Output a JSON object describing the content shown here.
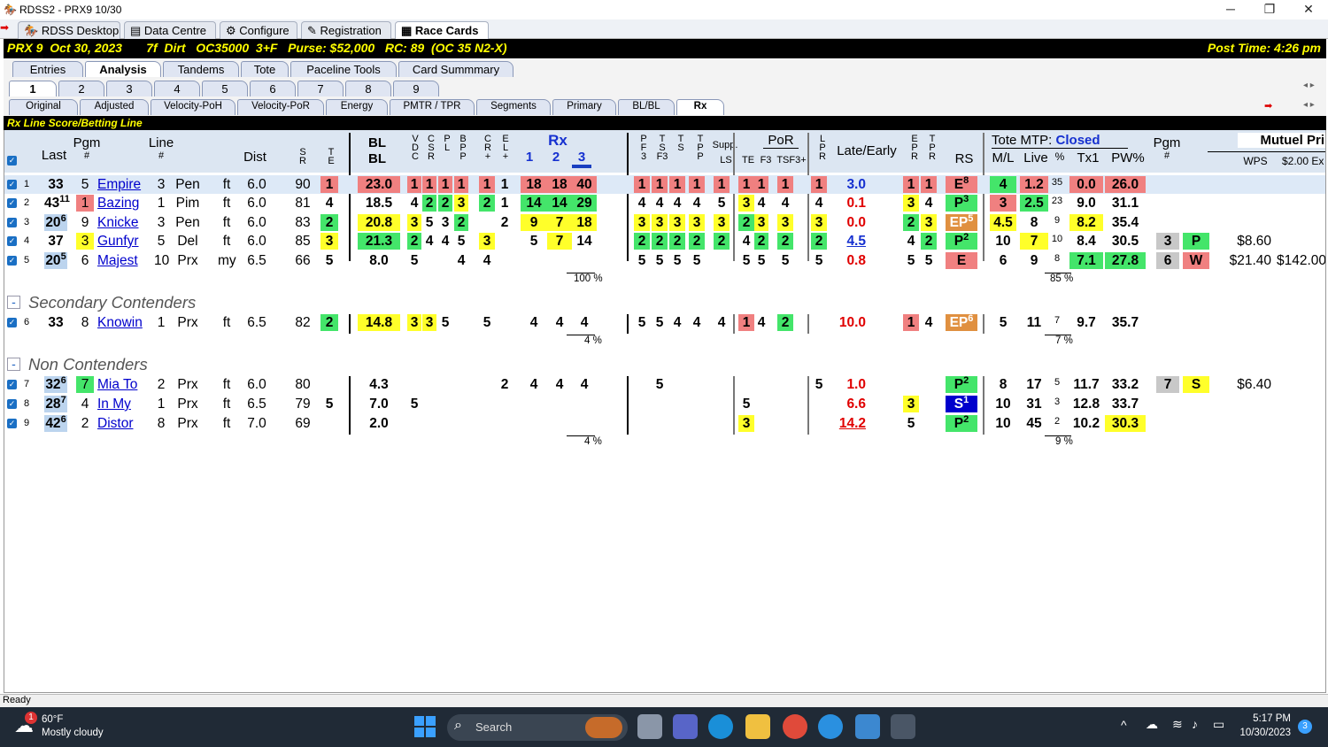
{
  "window": {
    "title": "RDSS2 - PRX9 10/30",
    "min": "─",
    "max": "❐",
    "close": "✕"
  },
  "app_tabs": [
    "RDSS Desktop",
    "Data Centre",
    "Configure",
    "Registration",
    "Race Cards"
  ],
  "race_bar": {
    "left": "PRX 9  Oct 30, 2023       7f  Dirt   OC35000  3+F   Purse: $52,000   RC: 89  (OC 35 N2-X)",
    "right": "Post Time: 4:26 pm"
  },
  "view_tabs": [
    "Entries",
    "Analysis",
    "Tandems",
    "Tote",
    "Paceline Tools",
    "Card Summmary"
  ],
  "race_tabs": [
    "1",
    "2",
    "3",
    "4",
    "5",
    "6",
    "7",
    "8",
    "9"
  ],
  "sub_tabs": [
    "Original",
    "Adjusted",
    "Velocity-PoH",
    "Velocity-PoR",
    "Energy",
    "PMTR / TPR",
    "Segments",
    "Primary",
    "BL/BL",
    "Rx"
  ],
  "rx_bar": "Rx Line Score/Betting Line",
  "headers": {
    "last": "Last",
    "pgm": "Pgm",
    "pgm_hash": "#",
    "line": "Line",
    "line_hash": "#",
    "dist": "Dist",
    "sr": "S\nR",
    "te": "T\nE",
    "bl1": "BL",
    "bl2": "BL",
    "vdc": "V\nD\nC",
    "csr": "C\nS\nR",
    "pl": "P\nL",
    "bpp": "B\nP\nP",
    "cr": "C\nR\n+",
    "el": "E\nL\n+",
    "rx": "Rx",
    "rx1": "1",
    "rx2": "2",
    "rx3": "3",
    "pf3": "P\nF\n3",
    "tsf3": "T\nS\nF3",
    "ts": "T\nS",
    "tpp": "T\nP\nP",
    "supp": "Supp.",
    "ls": "LS",
    "por": "PoR",
    "te_f3": "TE",
    "f3": "F3",
    "tsf3p": "TSF3+",
    "lpr": "L\nP\nR",
    "late_early": "Late/Early",
    "epr": "E\nP\nR",
    "tpr": "T\nP\nR",
    "rs": "RS",
    "tote": "Tote MTP:",
    "tote_status": "Closed",
    "ml": "M/L",
    "live": "Live",
    "pct": "%",
    "tx1": "Tx1",
    "pw": "PW%",
    "pgm2": "Pgm",
    "pgm2_hash": "#",
    "mutuel": "Mutuel Pri",
    "wps": "WPS",
    "ex": "$2.00 Ex"
  },
  "rows": [
    {
      "n": "1",
      "last": "33",
      "last_sup": "",
      "pgm": "5",
      "horse": "Empire",
      "line": "3",
      "trk": "Pen",
      "sfc": "ft",
      "dist": "6.0",
      "sr": "90",
      "te": "1",
      "bl": "23.0",
      "vdc": "1",
      "csr": "1",
      "pl": "1",
      "bpp": "1",
      "cr": "1",
      "el": "1",
      "rx1": "18",
      "rx2": "18",
      "rx3": "40",
      "pf3": "1",
      "tsf3": "1",
      "ts": "1",
      "tpp": "1",
      "ls": "1",
      "te2": "1",
      "f3": "1",
      "tsf3p": "1",
      "lpr": "1",
      "late": "3.0",
      "epr": "1",
      "tpr": "1",
      "rs": "E",
      "rs_sup": "8",
      "ml": "4",
      "live": "1.2",
      "pct": "35",
      "tx1": "0.0",
      "pw": "26.0"
    },
    {
      "n": "2",
      "last": "43",
      "last_sup": "11",
      "pgm": "1",
      "horse": "Bazing",
      "line": "1",
      "trk": "Pim",
      "sfc": "ft",
      "dist": "6.0",
      "sr": "81",
      "te": "4",
      "bl": "18.5",
      "vdc": "4",
      "csr": "2",
      "pl": "2",
      "bpp": "3",
      "cr": "2",
      "el": "1",
      "rx1": "14",
      "rx2": "14",
      "rx3": "29",
      "pf3": "4",
      "tsf3": "4",
      "ts": "4",
      "tpp": "4",
      "ls": "5",
      "te2": "3",
      "f3": "4",
      "tsf3p": "4",
      "lpr": "4",
      "late": "0.1",
      "epr": "3",
      "tpr": "4",
      "rs": "P",
      "rs_sup": "3",
      "ml": "3",
      "live": "2.5",
      "pct": "23",
      "tx1": "9.0",
      "pw": "31.1"
    },
    {
      "n": "3",
      "last": "20",
      "last_sup": "6",
      "pgm": "9",
      "horse": "Knicke",
      "line": "3",
      "trk": "Pen",
      "sfc": "ft",
      "dist": "6.0",
      "sr": "83",
      "te": "2",
      "bl": "20.8",
      "vdc": "3",
      "csr": "5",
      "pl": "3",
      "bpp": "2",
      "cr": "",
      "el": "2",
      "rx1": "9",
      "rx2": "7",
      "rx3": "18",
      "pf3": "3",
      "tsf3": "3",
      "ts": "3",
      "tpp": "3",
      "ls": "3",
      "te2": "2",
      "f3": "3",
      "tsf3p": "3",
      "lpr": "3",
      "late": "0.0",
      "epr": "2",
      "tpr": "3",
      "rs": "EP",
      "rs_sup": "5",
      "ml": "4.5",
      "live": "8",
      "pct": "9",
      "tx1": "8.2",
      "pw": "35.4"
    },
    {
      "n": "4",
      "last": "37",
      "last_sup": "",
      "pgm": "3",
      "horse": "Gunfyr",
      "line": "5",
      "trk": "Del",
      "sfc": "ft",
      "dist": "6.0",
      "sr": "85",
      "te": "3",
      "bl": "21.3",
      "vdc": "2",
      "csr": "4",
      "pl": "4",
      "bpp": "5",
      "cr": "3",
      "el": "",
      "rx1": "5",
      "rx2": "7",
      "rx3": "14",
      "pf3": "2",
      "tsf3": "2",
      "ts": "2",
      "tpp": "2",
      "ls": "2",
      "te2": "4",
      "f3": "2",
      "tsf3p": "2",
      "lpr": "2",
      "late": "4.5",
      "epr": "4",
      "tpr": "2",
      "rs": "P",
      "rs_sup": "2",
      "ml": "10",
      "live": "7",
      "pct": "10",
      "tx1": "8.4",
      "pw": "30.5",
      "fin_pgm": "3",
      "fin_pos": "P",
      "pay1": "$8.60",
      "pay2": ""
    },
    {
      "n": "5",
      "last": "20",
      "last_sup": "5",
      "pgm": "6",
      "horse": "Majest",
      "line": "10",
      "trk": "Prx",
      "sfc": "my",
      "dist": "6.5",
      "sr": "66",
      "te": "5",
      "bl": "8.0",
      "vdc": "5",
      "csr": "",
      "pl": "",
      "bpp": "4",
      "cr": "4",
      "el": "",
      "rx1": "",
      "rx2": "",
      "rx3": "",
      "pf3": "5",
      "tsf3": "5",
      "ts": "5",
      "tpp": "5",
      "ls": "",
      "te2": "5",
      "f3": "5",
      "tsf3p": "5",
      "lpr": "5",
      "late": "0.8",
      "epr": "5",
      "tpr": "5",
      "rs": "E",
      "rs_sup": "",
      "ml": "6",
      "live": "9",
      "pct": "8",
      "tx1": "7.1",
      "pw": "27.8",
      "fin_pgm": "6",
      "fin_pos": "W",
      "pay1": "$21.40",
      "pay2": "$142.00"
    },
    {
      "n": "6",
      "last": "33",
      "last_sup": "",
      "pgm": "8",
      "horse": "Knowin",
      "line": "1",
      "trk": "Prx",
      "sfc": "ft",
      "dist": "6.5",
      "sr": "82",
      "te": "2",
      "bl": "14.8",
      "vdc": "3",
      "csr": "3",
      "pl": "5",
      "bpp": "",
      "cr": "5",
      "el": "",
      "rx1": "4",
      "rx2": "4",
      "rx3": "4",
      "pf3": "5",
      "tsf3": "5",
      "ts": "4",
      "tpp": "4",
      "ls": "4",
      "te2": "1",
      "f3": "4",
      "tsf3p": "2",
      "lpr": "",
      "late": "10.0",
      "epr": "1",
      "tpr": "4",
      "rs": "EP",
      "rs_sup": "6",
      "ml": "5",
      "live": "11",
      "pct": "7",
      "tx1": "9.7",
      "pw": "35.7"
    },
    {
      "n": "7",
      "last": "32",
      "last_sup": "6",
      "pgm": "7",
      "horse": "Mia To",
      "line": "2",
      "trk": "Prx",
      "sfc": "ft",
      "dist": "6.0",
      "sr": "80",
      "te": "",
      "bl": "4.3",
      "vdc": "",
      "csr": "",
      "pl": "",
      "bpp": "",
      "cr": "",
      "el": "2",
      "rx1": "4",
      "rx2": "4",
      "rx3": "4",
      "pf3": "",
      "tsf3": "5",
      "ts": "",
      "tpp": "",
      "ls": "",
      "te2": "",
      "f3": "",
      "tsf3p": "",
      "lpr": "5",
      "late": "1.0",
      "epr": "",
      "tpr": "",
      "rs": "P",
      "rs_sup": "2",
      "ml": "8",
      "live": "17",
      "pct": "5",
      "tx1": "11.7",
      "pw": "33.2",
      "fin_pgm": "7",
      "fin_pos": "S",
      "pay1": "$6.40",
      "pay2": ""
    },
    {
      "n": "8",
      "last": "28",
      "last_sup": "7",
      "pgm": "4",
      "horse": "In My",
      "line": "1",
      "trk": "Prx",
      "sfc": "ft",
      "dist": "6.5",
      "sr": "79",
      "te": "5",
      "bl": "7.0",
      "vdc": "5",
      "csr": "",
      "pl": "",
      "bpp": "",
      "cr": "",
      "el": "",
      "rx1": "",
      "rx2": "",
      "rx3": "",
      "pf3": "",
      "tsf3": "",
      "ts": "",
      "tpp": "",
      "ls": "",
      "te2": "5",
      "f3": "",
      "tsf3p": "",
      "lpr": "",
      "late": "6.6",
      "epr": "3",
      "tpr": "",
      "rs": "S",
      "rs_sup": "1",
      "ml": "10",
      "live": "31",
      "pct": "3",
      "tx1": "12.8",
      "pw": "33.7"
    },
    {
      "n": "9",
      "last": "42",
      "last_sup": "6",
      "pgm": "2",
      "horse": "Distor",
      "line": "8",
      "trk": "Prx",
      "sfc": "ft",
      "dist": "7.0",
      "sr": "69",
      "te": "",
      "bl": "2.0",
      "vdc": "",
      "csr": "",
      "pl": "",
      "bpp": "",
      "cr": "",
      "el": "",
      "rx1": "",
      "rx2": "",
      "rx3": "",
      "pf3": "",
      "tsf3": "",
      "ts": "",
      "tpp": "",
      "ls": "",
      "te2": "3",
      "f3": "",
      "tsf3p": "",
      "lpr": "",
      "late": "14.2",
      "epr": "5",
      "tpr": "",
      "rs": "P",
      "rs_sup": "2",
      "ml": "10",
      "live": "45",
      "pct": "2",
      "tx1": "10.2",
      "pw": "30.3"
    }
  ],
  "sections": {
    "secondary": "Secondary Contenders",
    "non": "Non Contenders",
    "collapse": "-"
  },
  "pcts": {
    "rx_top": "100 %",
    "live_top": "85 %",
    "rx_mid": "4 %",
    "live_mid": "7 %",
    "rx_bot": "4 %",
    "live_bot": "9 %"
  },
  "status": "Ready",
  "taskbar": {
    "temp": "60°F",
    "weather": "Mostly cloudy",
    "badge": "1",
    "search": "Search",
    "time": "5:17 PM",
    "date": "10/30/2023",
    "notif": "3"
  }
}
